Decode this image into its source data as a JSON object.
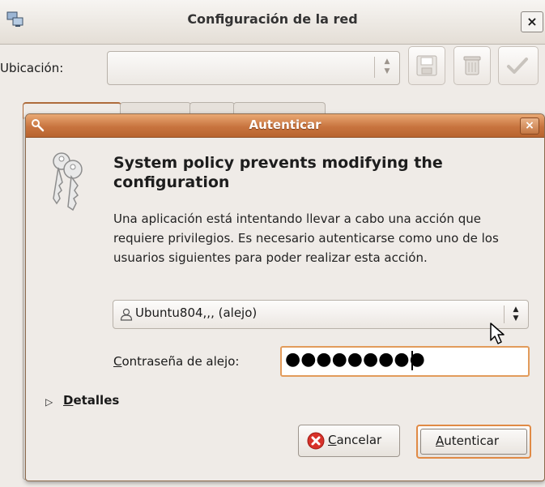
{
  "parent_window": {
    "title": "Configuración de la red",
    "close_glyph": "×",
    "location_label": "Ubicación:",
    "location_value": "",
    "toolbar_icons": [
      "save-icon",
      "delete-icon",
      "apply-check-icon"
    ]
  },
  "auth_dialog": {
    "title": "Autenticar",
    "close_glyph": "×",
    "heading": "System policy prevents modifying the configuration",
    "body": "Una aplicación está intentando llevar a cabo una acción que requiere privilegios. Es necesario autenticarse como uno de los usuarios siguientes para poder realizar esta acción.",
    "user_selected": "Ubuntu804,,, (alejo)",
    "password_label_mnemonic": "C",
    "password_label_rest": "ontraseña de alejo:",
    "password_value": "●●●●●●●●●",
    "details_mnemonic": "D",
    "details_rest": "etalles",
    "cancel_mnemonic": "C",
    "cancel_rest": "ancelar",
    "authenticate_mnemonic": "A",
    "authenticate_rest": "utenticar"
  },
  "colors": {
    "accent": "#c8743f",
    "window_bg": "#efebe7",
    "focus_border": "#e29b5b"
  }
}
